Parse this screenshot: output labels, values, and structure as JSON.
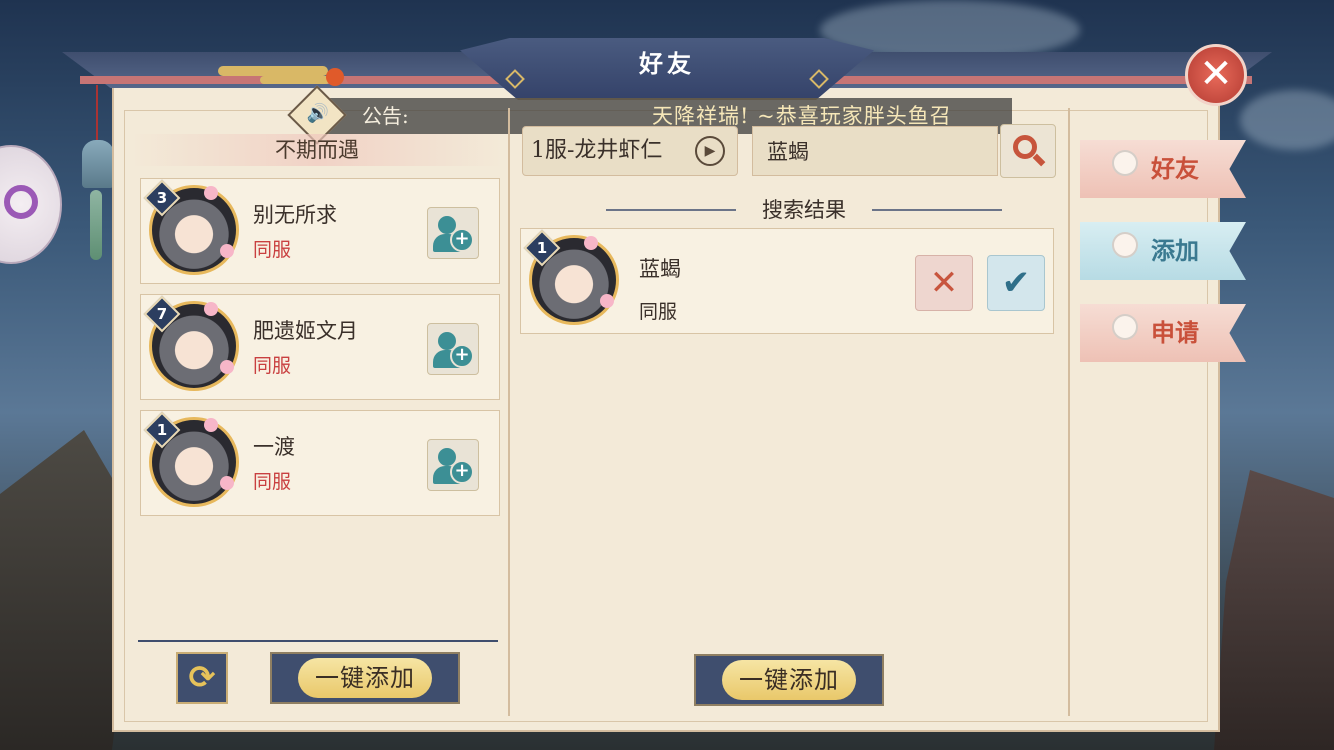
{
  "window": {
    "title": "好友"
  },
  "announcement": {
    "label": "公告:",
    "text": "天降祥瑞! ~恭喜玩家胖头鱼召"
  },
  "left_panel": {
    "header": "不期而遇",
    "players": [
      {
        "level": "3",
        "name": "别无所求",
        "server": "同服"
      },
      {
        "level": "7",
        "name": "肥遗姬文月",
        "server": "同服"
      },
      {
        "level": "1",
        "name": "一渡",
        "server": "同服"
      }
    ],
    "add_all_label": "一键添加"
  },
  "search_panel": {
    "server_value": "1服-龙井虾仁",
    "search_value": "蓝蝎",
    "results_title": "搜索结果",
    "result": {
      "level": "1",
      "name": "蓝蝎",
      "server": "同服"
    },
    "add_all_label": "一键添加"
  },
  "tabs": [
    {
      "label": "好友",
      "state": "inactive"
    },
    {
      "label": "添加",
      "state": "active"
    },
    {
      "label": "申请",
      "state": "inactive"
    }
  ],
  "colors": {
    "panel_bg": "#f3ead8",
    "frame_navy": "#3f4e6e",
    "server_text_red": "#c94040",
    "gold": "#e9c86a"
  }
}
